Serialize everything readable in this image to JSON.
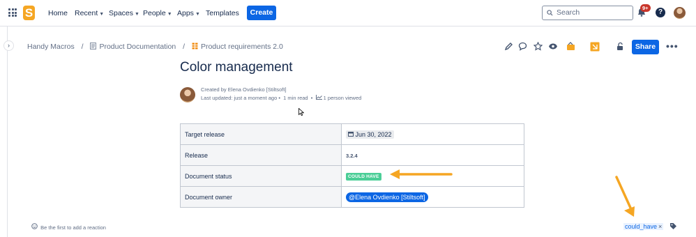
{
  "topbar": {
    "nav": [
      {
        "label": "Home",
        "has_menu": false
      },
      {
        "label": "Recent",
        "has_menu": true
      },
      {
        "label": "Spaces",
        "has_menu": true
      },
      {
        "label": "People",
        "has_menu": true
      },
      {
        "label": "Apps",
        "has_menu": true
      },
      {
        "label": "Templates",
        "has_menu": false
      }
    ],
    "create_label": "Create",
    "search_placeholder": "Search",
    "notification_badge": "9+",
    "help_label": "?",
    "logo_text": "S"
  },
  "breadcrumb": {
    "items": [
      "Handy Macros",
      "Product Documentation",
      "Product requirements 2.0"
    ],
    "separator": "/"
  },
  "toolbar": {
    "share_label": "Share",
    "more_label": "•••"
  },
  "page": {
    "title": "Color management",
    "created_by": "Created by Elena Ovdienko [Stiltsoft]",
    "last_updated": "Last updated: just a moment ago",
    "read_time": "1 min read",
    "viewed": "1 person viewed",
    "meta_sep": "•"
  },
  "properties": [
    {
      "key": "Target release",
      "value": "Jun 30, 2022",
      "kind": "date"
    },
    {
      "key": "Release",
      "value": "3.2.4",
      "kind": "bold"
    },
    {
      "key": "Document status",
      "value": "COULD HAVE",
      "kind": "status"
    },
    {
      "key": "Document owner",
      "value": "@Elena Ovdienko [Stiltsoft]",
      "kind": "mention"
    }
  ],
  "footer": {
    "reaction_text": "Be the first to add a reaction",
    "label": "could_have",
    "label_remove": "×"
  },
  "colors": {
    "brand": "#0c66e4",
    "status_green": "#4bce97",
    "annotation_arrow": "#f5a623",
    "badge_red": "#c9372c"
  }
}
